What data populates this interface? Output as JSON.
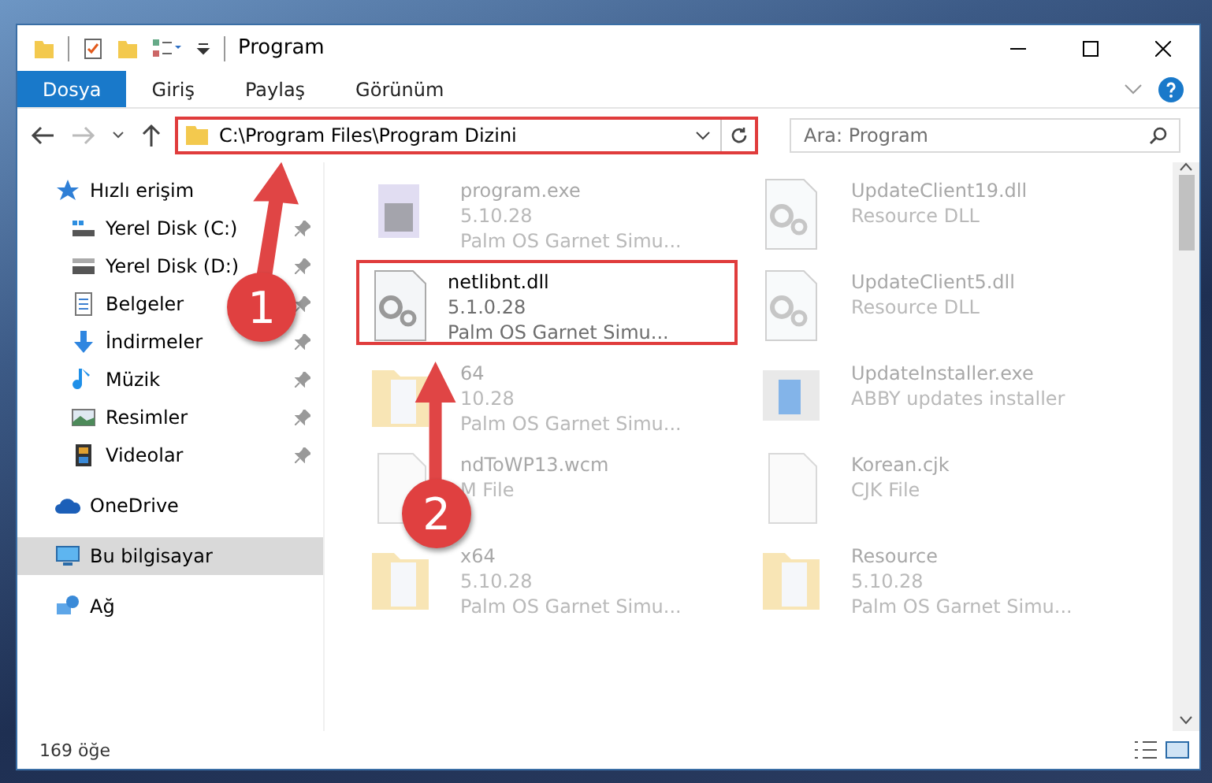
{
  "window": {
    "title": "Program"
  },
  "ribbon_tabs": [
    {
      "label": "Dosya",
      "selected": true
    },
    {
      "label": "Giriş",
      "selected": false
    },
    {
      "label": "Paylaş",
      "selected": false
    },
    {
      "label": "Görünüm",
      "selected": false
    }
  ],
  "address": {
    "path": "C:\\Program Files\\Program Dizini",
    "highlighted": true
  },
  "search": {
    "placeholder": "Ara: Program"
  },
  "nav": [
    {
      "label": "Hızlı erişim",
      "selected": false,
      "children": [
        {
          "label": "Yerel Disk (C:)",
          "pinned": true
        },
        {
          "label": "Yerel Disk (D:)",
          "pinned": true
        },
        {
          "label": "Belgeler",
          "pinned": true
        },
        {
          "label": "İndirmeler",
          "pinned": true
        },
        {
          "label": "Müzik",
          "pinned": true
        },
        {
          "label": "Resimler",
          "pinned": true
        },
        {
          "label": "Videolar",
          "pinned": true
        }
      ]
    },
    {
      "label": "OneDrive",
      "selected": false
    },
    {
      "label": "Bu bilgisayar",
      "selected": true
    },
    {
      "label": "Ağ",
      "selected": false
    }
  ],
  "files": [
    {
      "name": "program.exe",
      "lines": [
        "5.10.28",
        "Palm OS Garnet Simu..."
      ],
      "kind": "exe",
      "blurred": true,
      "highlighted": false
    },
    {
      "name": "UpdateClient19.dll",
      "lines": [
        "Resource DLL"
      ],
      "kind": "dll",
      "blurred": true,
      "highlighted": false
    },
    {
      "name": "netlibnt.dll",
      "lines": [
        "5.1.0.28",
        "Palm OS Garnet Simu..."
      ],
      "kind": "dll",
      "blurred": false,
      "highlighted": true
    },
    {
      "name": "UpdateClient5.dll",
      "lines": [
        "Resource DLL"
      ],
      "kind": "dll",
      "blurred": true,
      "highlighted": false
    },
    {
      "name": "64",
      "lines": [
        "10.28",
        "Palm OS Garnet Simu..."
      ],
      "kind": "folder",
      "blurred": true,
      "highlighted": false
    },
    {
      "name": "UpdateInstaller.exe",
      "lines": [
        "ABBY updates installer"
      ],
      "kind": "installer",
      "blurred": true,
      "highlighted": false
    },
    {
      "name": "ndToWP13.wcm",
      "lines": [
        "M File"
      ],
      "kind": "blank",
      "blurred": true,
      "highlighted": false
    },
    {
      "name": "Korean.cjk",
      "lines": [
        "CJK File"
      ],
      "kind": "blank",
      "blurred": true,
      "highlighted": false
    },
    {
      "name": "x64",
      "lines": [
        "5.10.28",
        "Palm OS Garnet Simu..."
      ],
      "kind": "folder",
      "blurred": true,
      "highlighted": false
    },
    {
      "name": "Resource",
      "lines": [
        "5.10.28",
        "Palm OS Garnet Simu..."
      ],
      "kind": "folder",
      "blurred": true,
      "highlighted": false
    }
  ],
  "status_bar": {
    "count": "169 öğe"
  },
  "callouts": [
    {
      "number": "1"
    },
    {
      "number": "2"
    }
  ]
}
